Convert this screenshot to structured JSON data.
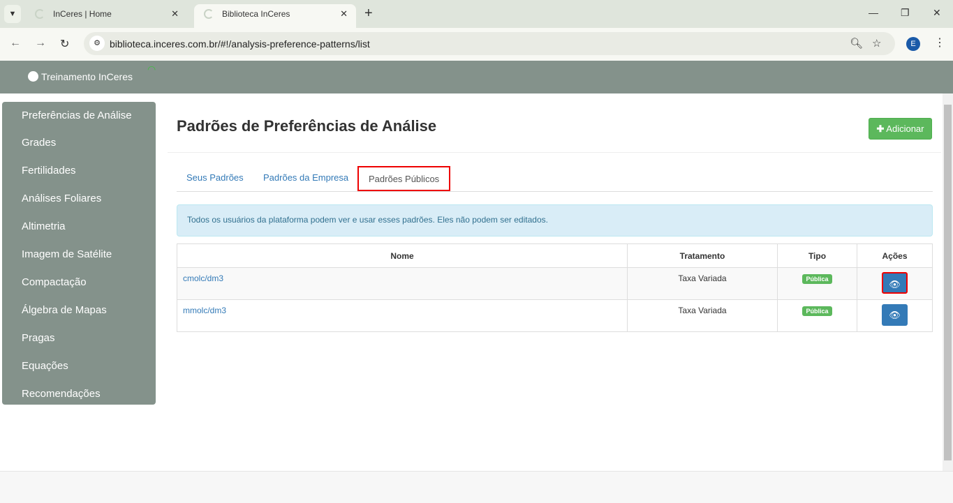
{
  "browser": {
    "tabs": [
      {
        "title": "InCeres | Home"
      },
      {
        "title": "Biblioteca InCeres"
      }
    ],
    "url": "biblioteca.inceres.com.br/#!/analysis-preference-patterns/list",
    "profile": "E"
  },
  "header": {
    "user": "Treinamento InCeres"
  },
  "sidebar": {
    "items": [
      "Preferências de Análise",
      "Grades",
      "Fertilidades",
      "Análises Foliares",
      "Altimetria",
      "Imagem de Satélite",
      "Compactação",
      "Álgebra de Mapas",
      "Pragas",
      "Equações",
      "Recomendações"
    ]
  },
  "main": {
    "title": "Padrões de Preferências de Análise",
    "add_label": "Adicionar",
    "tabs": [
      {
        "label": "Seus Padrões"
      },
      {
        "label": "Padrões da Empresa"
      },
      {
        "label": "Padrões Públicos",
        "active": true
      }
    ],
    "alert": "Todos os usuários da plataforma podem ver e usar esses padrões. Eles não podem ser editados.",
    "table": {
      "headers": [
        "Nome",
        "Tratamento",
        "Tipo",
        "Ações"
      ],
      "rows": [
        {
          "nome": "cmolc/dm3",
          "tratamento": "Taxa Variada",
          "tipo": "Pública"
        },
        {
          "nome": "mmolc/dm3",
          "tratamento": "Taxa Variada",
          "tipo": "Pública"
        }
      ]
    }
  },
  "colors": {
    "accent": "#337ab7",
    "success": "#5cb85c",
    "chrome": "#84928b",
    "highlight": "#ee0000"
  }
}
